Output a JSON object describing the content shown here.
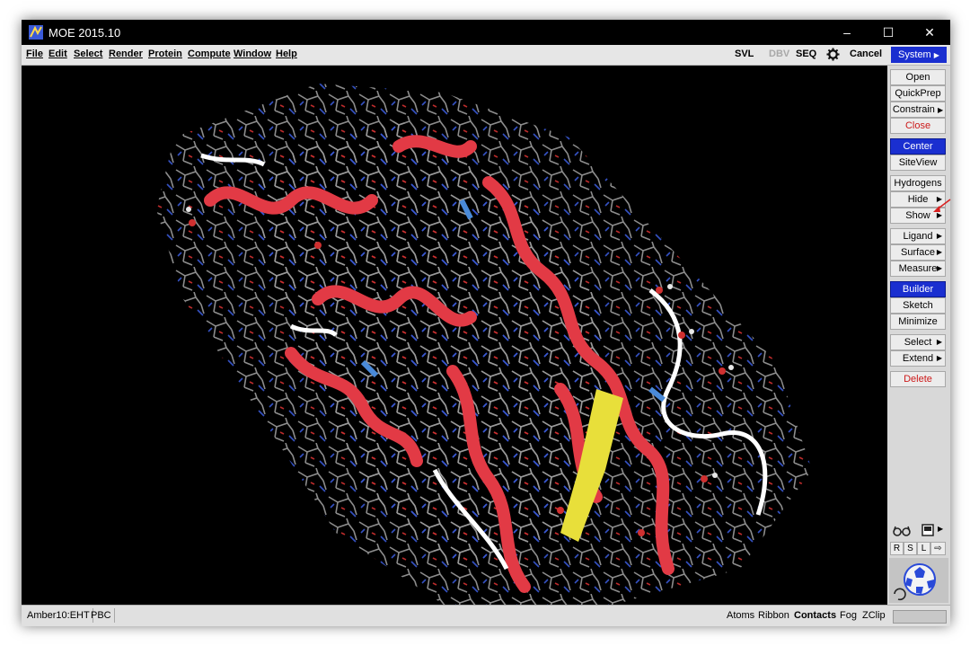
{
  "window": {
    "title": "MOE 2015.10"
  },
  "menubar": {
    "items": [
      "File",
      "Edit",
      "Select",
      "Render",
      "Protein",
      "Compute",
      "Window",
      "Help"
    ],
    "right": {
      "svl": "SVL",
      "dbv": "DBV",
      "seq": "SEQ",
      "cancel": "Cancel",
      "system": "System"
    }
  },
  "sidebar": {
    "open": "Open",
    "quickprep": "QuickPrep",
    "constrain": "Constrain",
    "close": "Close",
    "center": "Center",
    "siteview": "SiteView",
    "hydrogens": "Hydrogens",
    "hide": "Hide",
    "show": "Show",
    "ligand": "Ligand",
    "surface": "Surface",
    "measure": "Measure",
    "builder": "Builder",
    "sketch": "Sketch",
    "minimize": "Minimize",
    "select": "Select",
    "extend": "Extend",
    "delete": "Delete",
    "rsl": [
      "R",
      "S",
      "L"
    ]
  },
  "statusbar": {
    "forcefield": "Amber10:EHT",
    "pbc": "PBC",
    "toggles": [
      "Atoms",
      "Ribbon",
      "Contacts",
      "Fog",
      "ZClip"
    ]
  },
  "colors": {
    "accent": "#1a2fd0",
    "helix": "#e23a45",
    "sheet": "#e8df3a",
    "coil": "#ffffff",
    "turn": "#4a8ad8"
  }
}
